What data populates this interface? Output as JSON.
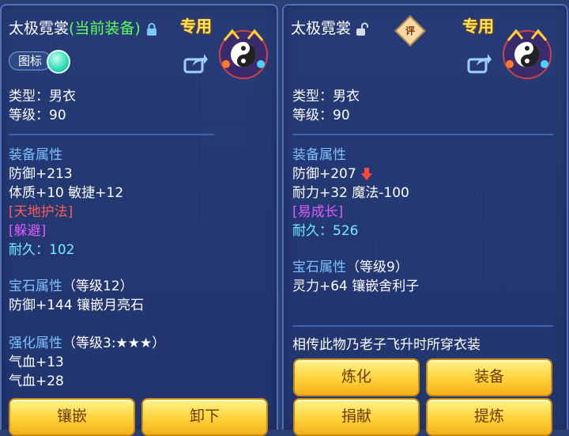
{
  "left": {
    "name": "太极霓裳",
    "status": "(当前装备)",
    "special": "专用",
    "icon_label": "图标",
    "type_line": "类型：男衣",
    "level_line": "等级：90",
    "attr_header": "装备属性",
    "defense": "防御+213",
    "stats": "体质+10 敏捷+12",
    "special_skill": "[天地护法]",
    "effect": "[躲避]",
    "durability": "耐久：102",
    "gem_header": "宝石属性",
    "gem_level": "（等级12）",
    "gem_detail": "防御+144 镶嵌月亮石",
    "enhance_header": "强化属性",
    "enhance_level": "（等级3:★★★）",
    "enhance_1": "气血+13",
    "enhance_2": "气血+28",
    "btn_inlay": "镶嵌",
    "btn_unequip": "卸下"
  },
  "right": {
    "name": "太极霓裳",
    "special": "专用",
    "rate_badge": "评",
    "type_line": "类型：男衣",
    "level_line": "等级：90",
    "attr_header": "装备属性",
    "defense": "防御+207",
    "stats": "耐力+32 魔法-100",
    "special_skill": "[易成长]",
    "durability": "耐久：526",
    "gem_header": "宝石属性",
    "gem_level": "（等级9）",
    "gem_detail": "灵力+64 镶嵌舍利子",
    "description": "相传此物乃老子飞升时所穿衣装",
    "btn_refine": "炼化",
    "btn_equip": "装备",
    "btn_donate": "捐献",
    "btn_extract": "提炼"
  },
  "colors": {
    "panel": "#263a76",
    "title": "#ffffff",
    "current_equipped": "#5dff5d",
    "special": "#ffe45a",
    "header": "#7fc1ff",
    "skill": "#ff5a5a",
    "effect": "#e15aff",
    "durability": "#6ff0ff",
    "button": "#ffd23a"
  },
  "icons": [
    "lock-icon",
    "unlock-icon",
    "share-icon",
    "taiji-emblem-icon",
    "red-down-arrow-icon",
    "toggle-knob-icon"
  ]
}
